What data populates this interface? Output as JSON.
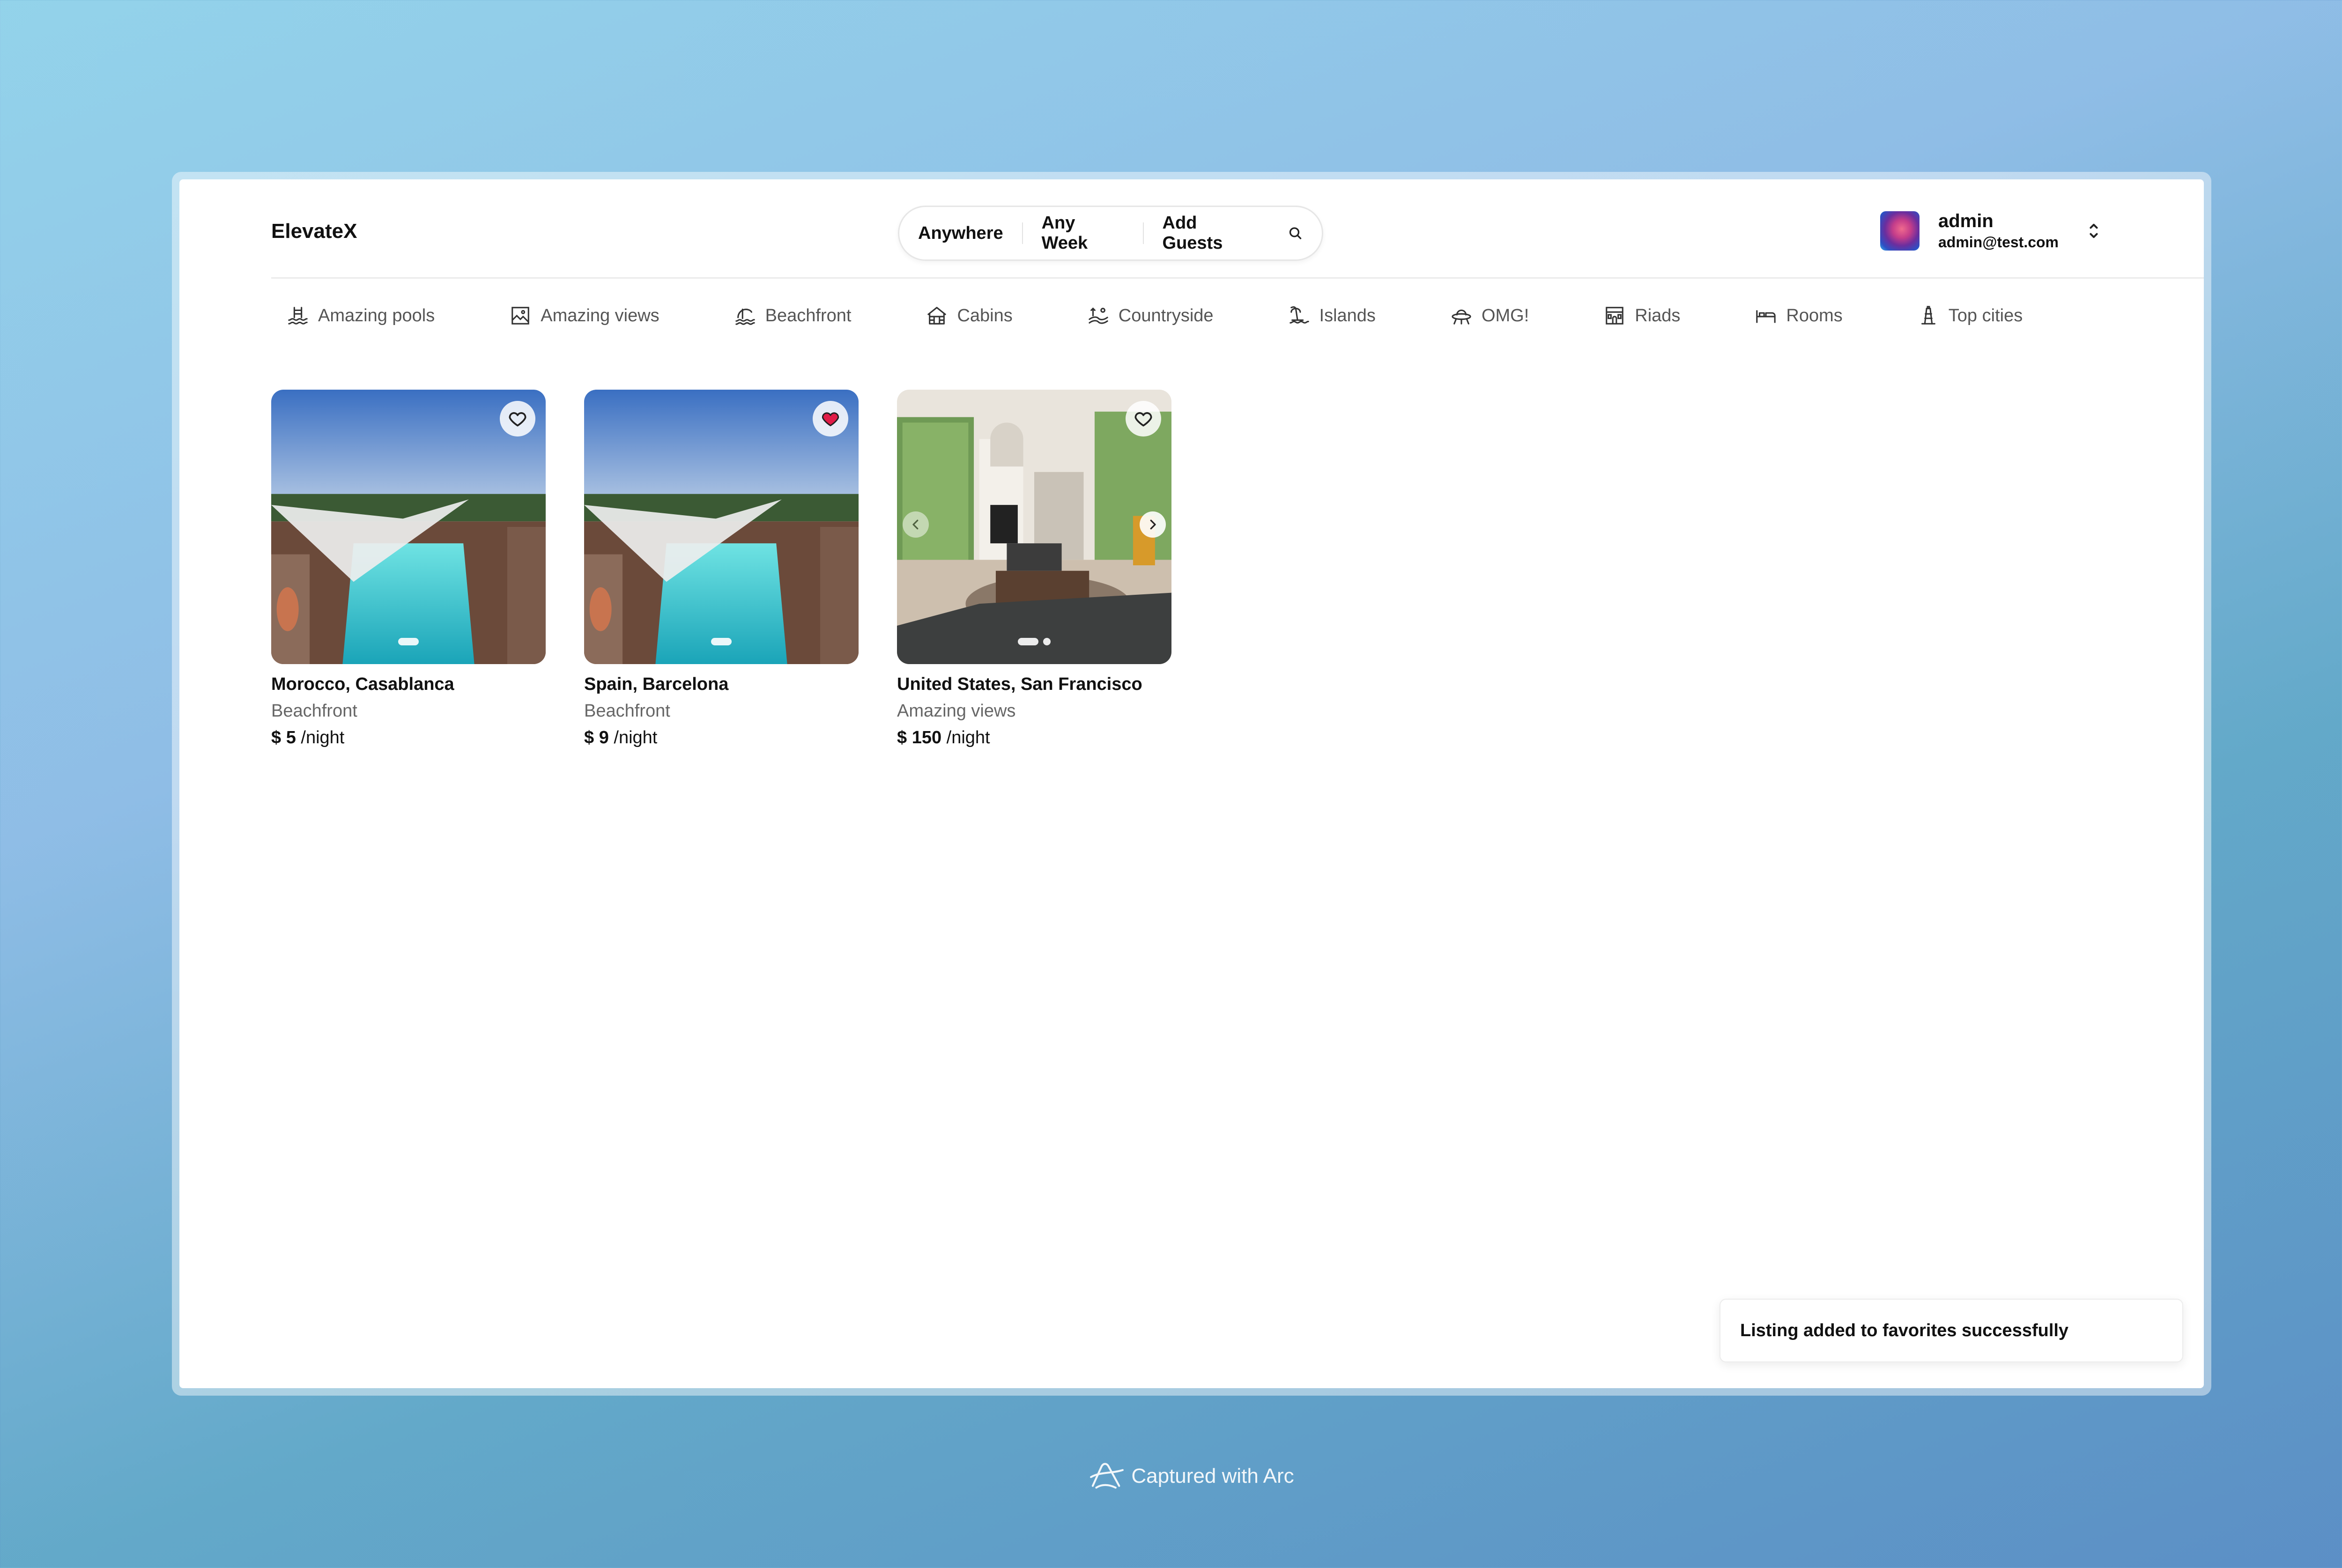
{
  "app": {
    "logo": "ElevateX"
  },
  "search": {
    "location": "Anywhere",
    "date": "Any Week",
    "guests": "Add Guests"
  },
  "user": {
    "name": "admin",
    "email": "admin@test.com"
  },
  "categories": [
    {
      "label": "Amazing pools",
      "icon": "pool-icon"
    },
    {
      "label": "Amazing views",
      "icon": "views-icon"
    },
    {
      "label": "Beachfront",
      "icon": "beachfront-icon"
    },
    {
      "label": "Cabins",
      "icon": "cabin-icon"
    },
    {
      "label": "Countryside",
      "icon": "countryside-icon"
    },
    {
      "label": "Islands",
      "icon": "island-icon"
    },
    {
      "label": "OMG!",
      "icon": "ufo-icon"
    },
    {
      "label": "Riads",
      "icon": "riad-icon"
    },
    {
      "label": "Rooms",
      "icon": "room-icon"
    },
    {
      "label": "Top cities",
      "icon": "tower-icon"
    }
  ],
  "listings": [
    {
      "title": "Morocco, Casablanca",
      "category": "Beachfront",
      "price": "$ 5",
      "unit": "/night",
      "favorited": false,
      "image": "pool"
    },
    {
      "title": "Spain, Barcelona",
      "category": "Beachfront",
      "price": "$ 9",
      "unit": "/night",
      "favorited": true,
      "image": "pool"
    },
    {
      "title": "United States, San Francisco",
      "category": "Amazing views",
      "price": "$ 150",
      "unit": "/night",
      "favorited": false,
      "image": "living-room"
    }
  ],
  "toast": {
    "message": "Listing added to favorites successfully"
  },
  "footer": {
    "captured": "Captured with Arc"
  },
  "colors": {
    "heart_active": "#e11d48"
  }
}
